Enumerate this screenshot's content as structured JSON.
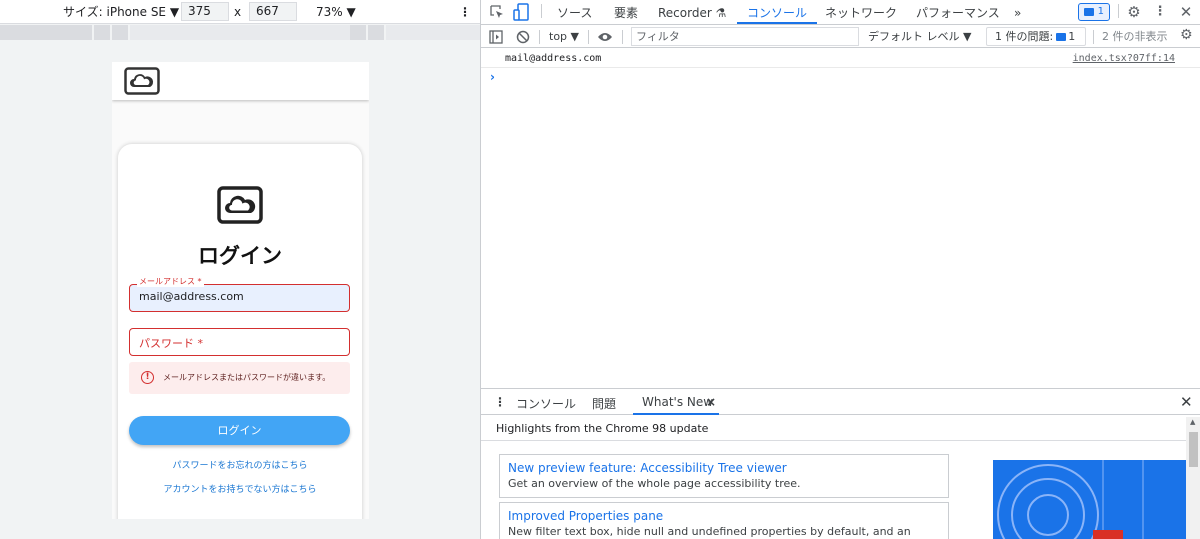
{
  "emulation": {
    "device_label": "サイズ: iPhone SE ▼",
    "width": "375",
    "times": "x",
    "height": "667",
    "zoom": "73% ▼"
  },
  "app": {
    "login_title": "ログイン",
    "email": {
      "label": "メールアドレス *",
      "value": "mail@address.com"
    },
    "password": {
      "placeholder": "パスワード *"
    },
    "alert": {
      "icon": "!",
      "text": "メールアドレスまたはパスワードが違います。"
    },
    "login_button": "ログイン",
    "forgot_password_link": "パスワードをお忘れの方はこちら",
    "no_account_link": "アカウントをお持ちでない方はこちら"
  },
  "devtools": {
    "tabs": {
      "sources": "ソース",
      "elements": "要素",
      "recorder": "Recorder ⚗",
      "console": "コンソール",
      "network": "ネットワーク",
      "performance": "パフォーマンス",
      "more": "»"
    },
    "issues_badge": "1",
    "console_toolbar": {
      "context": "top ▼",
      "filter_placeholder": "フィルタ",
      "levels": "デフォルト レベル ▼",
      "issues_text": "1 件の問題:",
      "issues_num": "1",
      "hidden": "2 件の非表示"
    },
    "log": {
      "message": "mail@address.com",
      "source": "index.tsx?07ff:14"
    },
    "prompt": "›",
    "drawer": {
      "tab_console": "コンソール",
      "tab_issues": "問題",
      "tab_whats_new": "What's New",
      "tab_close": "×",
      "highlights": "Highlights from the Chrome 98 update",
      "features": [
        {
          "title": "New preview feature: Accessibility Tree viewer",
          "desc": "Get an overview of the whole page accessibility tree."
        },
        {
          "title": "Improved Properties pane",
          "desc": "New filter text box, hide null and undefined properties by default, and an option"
        }
      ]
    }
  },
  "colors": {
    "accent": "#1a73e8",
    "error": "#d32f2f",
    "button": "#42a5f5"
  }
}
